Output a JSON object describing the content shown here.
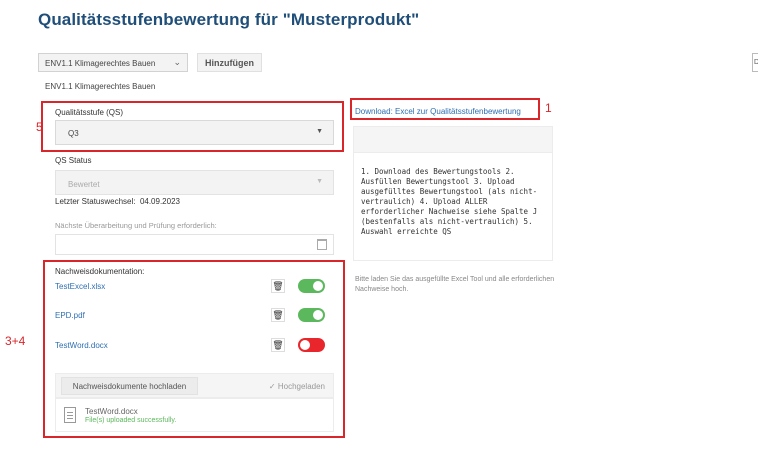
{
  "page": {
    "title": "Qualitätsstufenbewertung für \"Musterprodukt\""
  },
  "toolbar": {
    "criterion_select_value": "ENV1.1 Klimagerechtes Bauen",
    "add_button_label": "Hinzufügen",
    "right_edge_label": "D"
  },
  "section": {
    "label": "ENV1.1 Klimagerechtes Bauen"
  },
  "qs": {
    "label": "Qualitätsstufe (QS)",
    "value": "Q3"
  },
  "status": {
    "label": "QS Status",
    "value": "Bewertet",
    "last_change_label": "Letzter Statuswechsel:",
    "last_change_value": "04.09.2023"
  },
  "review": {
    "label": "Nächste Überarbeitung und Prüfung erforderlich:",
    "value": ""
  },
  "documents": {
    "label": "Nachweisdokumentation:",
    "items": [
      {
        "name": "TestExcel.xlsx",
        "enabled": true
      },
      {
        "name": "EPD.pdf",
        "enabled": true
      },
      {
        "name": "TestWord.docx",
        "enabled": false
      }
    ],
    "upload_button_label": "Nachweisdokumente hochladen",
    "uploaded_label": "✓ Hochgeladen",
    "uploaded_file": {
      "name": "TestWord.docx",
      "status": "File(s) uploaded successfully."
    }
  },
  "download": {
    "link_label": "Download: Excel zur Qualitätsstufenbewertung",
    "instructions": "1. Download des Bewertungstools 2. Ausfüllen Bewertungstool 3. Upload ausgefülltes Bewertungstool (als nicht-vertraulich) 4. Upload ALLER erforderlicher Nachweise siehe Spalte J (bestenfalls als nicht-vertraulich) 5. Auswahl erreichte QS",
    "hint": "Bitte laden Sie das ausgefüllte Excel Tool und alle erforderlichen Nachweise hoch."
  },
  "annotations": {
    "download": "1",
    "qs": "5",
    "documents": "3+4"
  },
  "colors": {
    "title": "#1f4e79",
    "link": "#2f6fb2",
    "toggle_on": "#5cb85c",
    "toggle_off": "#e8262b",
    "annotation": "#d9262b"
  },
  "icons": {
    "chevron": "chevron-down-icon",
    "caret": "caret-down-icon",
    "calendar": "calendar-icon",
    "trash": "trash-icon",
    "check": "check-icon",
    "file": "document-icon"
  }
}
